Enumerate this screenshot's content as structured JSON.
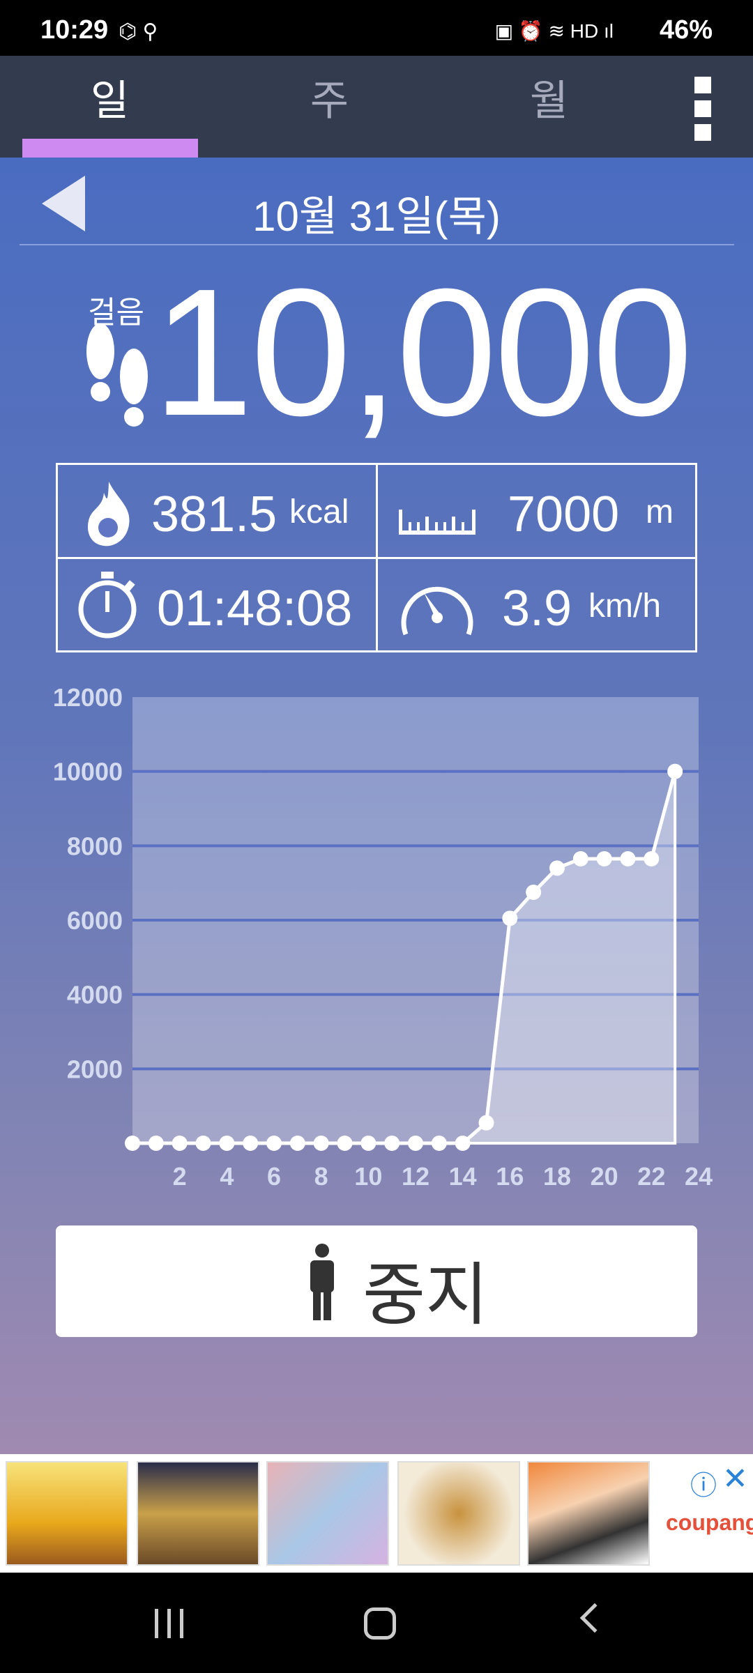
{
  "status_bar": {
    "time": "10:29",
    "left_icons": "⌬ ⚲",
    "right_icons": "▣ ⏰ ≋ HD ıl",
    "battery": "46%"
  },
  "tabs": [
    {
      "label": "일",
      "active": true
    },
    {
      "label": "주",
      "active": false
    },
    {
      "label": "월",
      "active": false
    }
  ],
  "header": {
    "date": "10월 31일(목)"
  },
  "steps": {
    "label": "걸음",
    "value": "10,000"
  },
  "stats": {
    "calories": {
      "value": "381.5",
      "unit": "kcal"
    },
    "distance": {
      "value": "7000",
      "unit": "m"
    },
    "duration": {
      "value": "01:48:08"
    },
    "speed": {
      "value": "3.9",
      "unit": "km/h"
    }
  },
  "chart_data": {
    "type": "area",
    "x": [
      0,
      1,
      2,
      3,
      4,
      5,
      6,
      7,
      8,
      9,
      10,
      11,
      12,
      13,
      14,
      15,
      16,
      17,
      18,
      19,
      20,
      21,
      22,
      23
    ],
    "values": [
      0,
      0,
      0,
      0,
      0,
      0,
      0,
      0,
      0,
      0,
      0,
      0,
      0,
      0,
      0,
      550,
      6050,
      6750,
      7400,
      7650,
      7650,
      7650,
      7650,
      10000
    ],
    "xticks": [
      "2",
      "4",
      "6",
      "8",
      "10",
      "12",
      "14",
      "16",
      "18",
      "20",
      "22",
      "24"
    ],
    "yticks": [
      "2000",
      "4000",
      "6000",
      "8000",
      "10000",
      "12000"
    ],
    "xlim": [
      0,
      24
    ],
    "ylim": [
      0,
      12000
    ],
    "grid": true
  },
  "stop_button": {
    "label": "중지"
  },
  "ad": {
    "brand": "coupang",
    "info": "ⓘ",
    "close": "✕"
  },
  "colors": {
    "accent": "#cf8af2",
    "tabbar": "#333b4f"
  }
}
